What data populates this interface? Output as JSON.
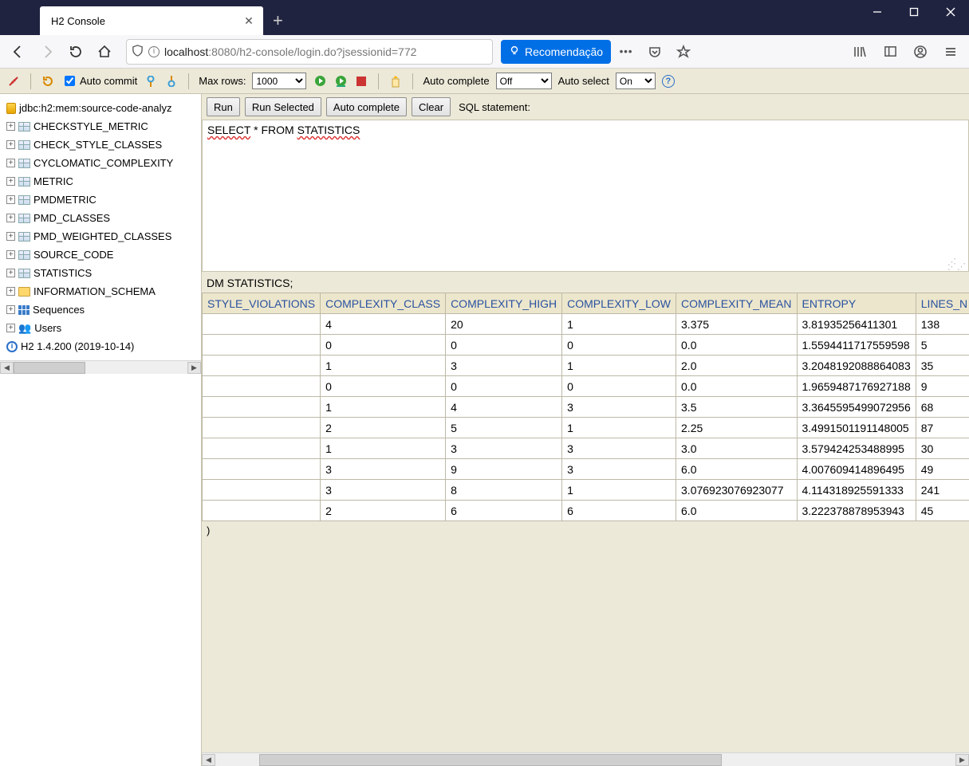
{
  "browser": {
    "tab_title": "H2 Console",
    "newtab_label": "+",
    "url_prefix": "localhost",
    "url_rest": ":8080/h2-console/login.do?jsessionid=772",
    "recommend_label": "Recomendação",
    "kebab": "•••"
  },
  "toolbar": {
    "autocommit_label": "Auto commit",
    "maxrows_label": "Max rows:",
    "maxrows_value": "1000",
    "autocomplete_label": "Auto complete",
    "autocomplete_value": "Off",
    "autoselect_label": "Auto select",
    "autoselect_value": "On"
  },
  "tree": {
    "db_label": "jdbc:h2:mem:source-code-analyz",
    "tables": [
      "CHECKSTYLE_METRIC",
      "CHECK_STYLE_CLASSES",
      "CYCLOMATIC_COMPLEXITY",
      "METRIC",
      "PMDMETRIC",
      "PMD_CLASSES",
      "PMD_WEIGHTED_CLASSES",
      "SOURCE_CODE",
      "STATISTICS"
    ],
    "schema_label": "INFORMATION_SCHEMA",
    "sequences_label": "Sequences",
    "users_label": "Users",
    "version_label": "H2 1.4.200 (2019-10-14)"
  },
  "sqlbar": {
    "run": "Run",
    "run_selected": "Run Selected",
    "auto_complete": "Auto complete",
    "clear": "Clear",
    "stmt_label": "SQL statement:"
  },
  "sql": {
    "prefix": "SELECT",
    "mid": " * FROM ",
    "suffix": "STATISTICS"
  },
  "result": {
    "caption": "DM STATISTICS;",
    "columns": [
      "STYLE_VIOLATIONS",
      "COMPLEXITY_CLASS",
      "COMPLEXITY_HIGH",
      "COMPLEXITY_LOW",
      "COMPLEXITY_MEAN",
      "ENTROPY",
      "LINES_N"
    ],
    "rows": [
      [
        "",
        "4",
        "20",
        "1",
        "3.375",
        "3.81935256411301",
        "138"
      ],
      [
        "",
        "0",
        "0",
        "0",
        "0.0",
        "1.5594411717559598",
        "5"
      ],
      [
        "",
        "1",
        "3",
        "1",
        "2.0",
        "3.2048192088864083",
        "35"
      ],
      [
        "",
        "0",
        "0",
        "0",
        "0.0",
        "1.9659487176927188",
        "9"
      ],
      [
        "",
        "1",
        "4",
        "3",
        "3.5",
        "3.3645595499072956",
        "68"
      ],
      [
        "",
        "2",
        "5",
        "1",
        "2.25",
        "3.4991501191148005",
        "87"
      ],
      [
        "",
        "1",
        "3",
        "3",
        "3.0",
        "3.579424253488995",
        "30"
      ],
      [
        "",
        "3",
        "9",
        "3",
        "6.0",
        "4.007609414896495",
        "49"
      ],
      [
        "",
        "3",
        "8",
        "1",
        "3.076923076923077",
        "4.114318925591333",
        "241"
      ],
      [
        "",
        "2",
        "6",
        "6",
        "6.0",
        "3.222378878953943",
        "45"
      ]
    ],
    "closing_paren": ")"
  }
}
